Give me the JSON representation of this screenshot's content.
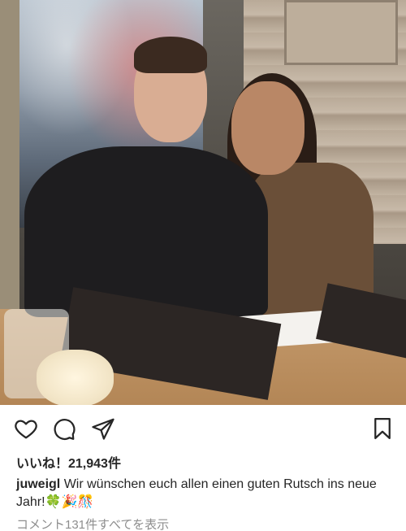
{
  "post": {
    "photo_alt": "",
    "likes_text": "いいね！21,943件",
    "caption_user": "juweigl",
    "caption_text": "Wir wünschen euch allen einen guten Rutsch ins neue Jahr!🍀🎉🎊",
    "view_comments": "コメント131件すべてを表示"
  },
  "icons": {
    "like": "heart-icon",
    "comment": "comment-bubble-icon",
    "share": "paper-plane-icon",
    "save": "bookmark-icon"
  }
}
